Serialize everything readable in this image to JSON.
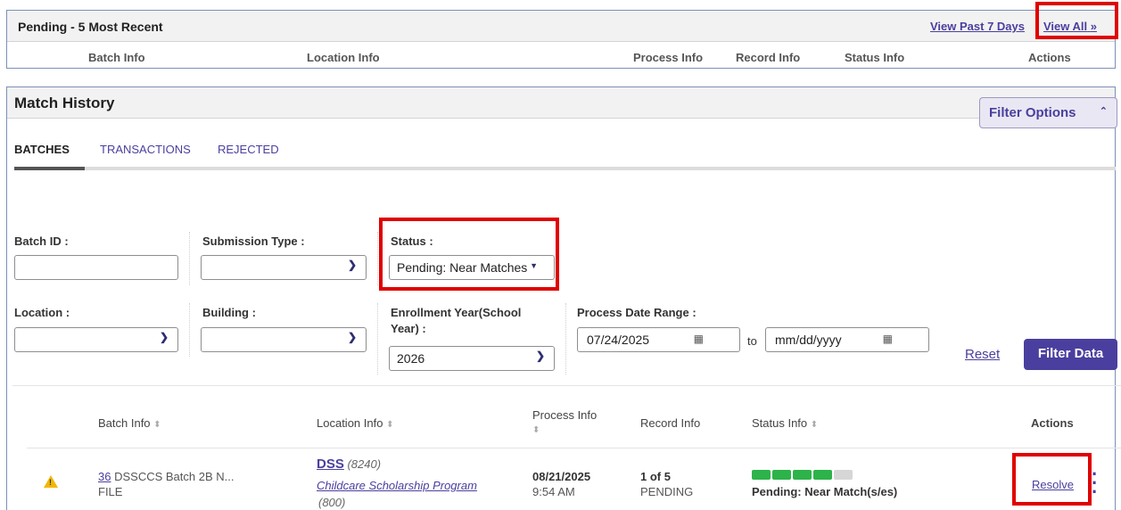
{
  "pending": {
    "title": "Pending - 5 Most Recent",
    "view_past_7_days": "View Past 7 Days",
    "view_all": "View All",
    "columns": [
      "Batch Info",
      "Location Info",
      "Process Info",
      "Record Info",
      "Status Info",
      "Actions"
    ]
  },
  "match_history": {
    "title": "Match History",
    "tabs": [
      "BATCHES",
      "TRANSACTIONS",
      "REJECTED"
    ],
    "filter_options": "Filter Options",
    "filters": {
      "batch_id_label": "Batch ID :",
      "batch_id_value": "",
      "submission_type_label": "Submission Type :",
      "submission_type_value": "",
      "status_label": "Status :",
      "status_value": "Pending: Near Matches",
      "location_label": "Location :",
      "location_value": "",
      "building_label": "Building :",
      "building_value": "",
      "enrollment_year_label_1": "Enrollment Year(School",
      "enrollment_year_label_2": "Year) :",
      "enrollment_year_value": "2026",
      "process_date_label": "Process Date Range :",
      "date_from": "07/24/2025",
      "date_to_sep": "to",
      "date_to_placeholder": "mm/dd/yyyy"
    },
    "reset": "Reset",
    "filter_data": "Filter Data",
    "table_headers": {
      "batch_info": "Batch Info",
      "location_info": "Location Info",
      "process_info": "Process Info",
      "record_info": "Record Info",
      "status_info": "Status Info",
      "actions": "Actions"
    },
    "rows": [
      {
        "batch_id": "36",
        "batch_name": "DSSCCS Batch 2B N...",
        "batch_type": "FILE",
        "location_code": "DSS",
        "location_number": "(8240)",
        "program": "Childcare Scholarship Program",
        "program_number": "(800)",
        "process_date": "08/21/2025",
        "process_time": "9:54 AM",
        "record_count": "1 of 5",
        "record_status": "PENDING",
        "status_text": "Pending: Near Match(s/es)",
        "progress_filled": 4,
        "progress_total": 5,
        "action": "Resolve"
      }
    ]
  },
  "colors": {
    "accent": "#4a3f9e",
    "progress_green": "#2db34a",
    "progress_grey": "#d6d6d6",
    "highlight": "#e00000",
    "warning": "#f2b705"
  }
}
